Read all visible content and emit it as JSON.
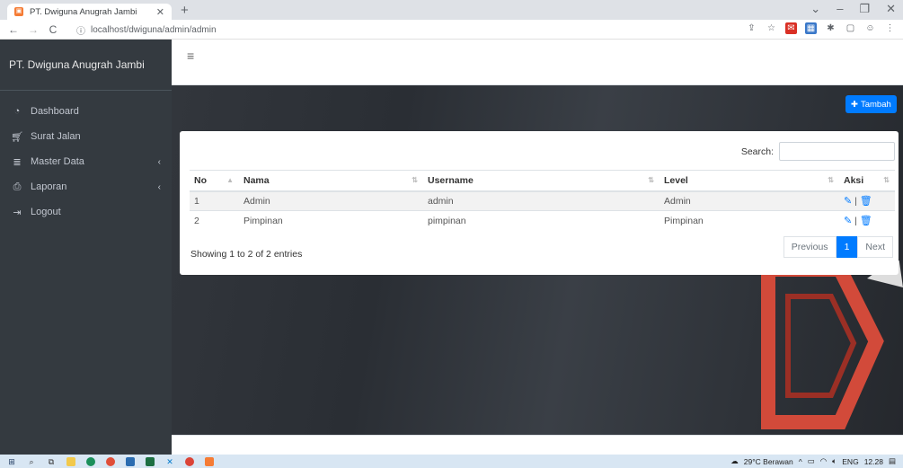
{
  "browser": {
    "tab_title": "PT. Dwiguna Anugrah Jambi",
    "url": "localhost/dwiguna/admin/admin"
  },
  "sidebar": {
    "brand": "PT. Dwiguna Anugrah Jambi",
    "items": [
      {
        "label": "Dashboard",
        "icon": "dashboard-icon"
      },
      {
        "label": "Surat Jalan",
        "icon": "cart-icon"
      },
      {
        "label": "Master Data",
        "icon": "database-icon"
      },
      {
        "label": "Laporan",
        "icon": "print-icon"
      },
      {
        "label": "Logout",
        "icon": "logout-icon"
      }
    ]
  },
  "main": {
    "add_button": "Tambah",
    "search_label": "Search:",
    "search_value": "",
    "table": {
      "columns": [
        "No",
        "Nama",
        "Username",
        "Level",
        "Aksi"
      ],
      "rows": [
        [
          "1",
          "Admin",
          "admin",
          "Admin"
        ],
        [
          "2",
          "Pimpinan",
          "pimpinan",
          "Pimpinan"
        ]
      ]
    },
    "info": "Showing 1 to 2 of 2 entries",
    "pagination": {
      "previous": "Previous",
      "current": "1",
      "next": "Next"
    }
  },
  "taskbar": {
    "weather": "29°C  Berawan",
    "lang": "ENG",
    "time": "12.28"
  },
  "colors": {
    "primary": "#007bff",
    "sidebar": "#343a40"
  }
}
